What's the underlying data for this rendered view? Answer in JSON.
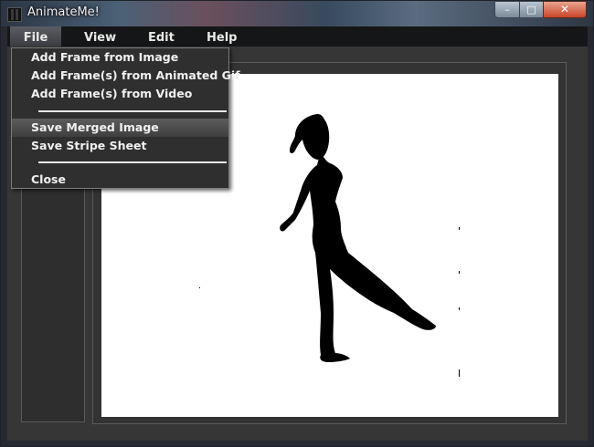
{
  "window": {
    "title": "AnimateMe!"
  },
  "menubar": {
    "items": [
      "File",
      "View",
      "Edit",
      "Help"
    ]
  },
  "file_menu": {
    "items": [
      "Add Frame from Image",
      "Add Frame(s) from Animated Gif",
      "Add Frame(s) from Video",
      "Save Merged Image",
      "Save Stripe Sheet",
      "Close"
    ],
    "highlighted": "Save Merged Image"
  },
  "window_buttons": {
    "minimize": "–",
    "maximize": "□",
    "close": "✕"
  },
  "colors": {
    "canvas_bg": "#ffffff",
    "silhouette": "#000000",
    "window_bg": "#363636"
  }
}
